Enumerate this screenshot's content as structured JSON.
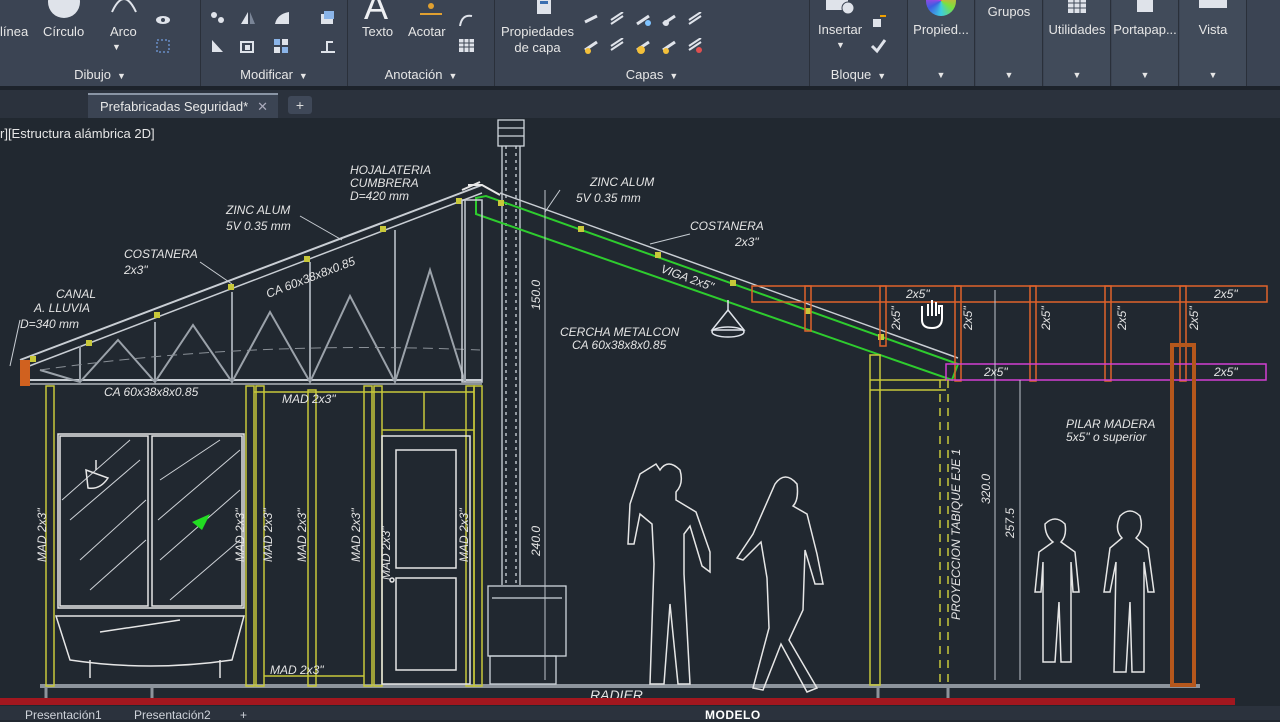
{
  "ribbon": {
    "draw": {
      "linea": "línea",
      "circulo": "Círculo",
      "arco": "Arco",
      "title": "Dibujo"
    },
    "modify": {
      "title": "Modificar"
    },
    "annotation": {
      "texto": "Texto",
      "acotar": "Acotar",
      "title": "Anotación"
    },
    "layers": {
      "prop_line1": "Propiedades",
      "prop_line2": "de capa",
      "title": "Capas"
    },
    "block": {
      "insertar": "Insertar",
      "title": "Bloque"
    },
    "tiles": {
      "propiedades": "Propied...",
      "grupos": "Grupos",
      "utilidades": "Utilidades",
      "portapapeles": "Portapap...",
      "vista": "Vista"
    },
    "dropdown_arrow": "▼"
  },
  "tabs": {
    "document": "Prefabricadas Seguridad*",
    "close": "✕",
    "add": "+"
  },
  "viewport_label": "r][Estructura alámbrica 2D]",
  "drawing": {
    "hojalateria": "HOJALATERIA",
    "cumbrera": "CUMBRERA",
    "hoja_d": "D=420 mm",
    "zinc_left_1": "ZINC ALUM",
    "zinc_left_2": "5V 0.35 mm",
    "zinc_right_1": "ZINC ALUM",
    "zinc_right_2": "5V 0.35 mm",
    "costanera_left_1": "COSTANERA",
    "costanera_left_2": "2x3\"",
    "costanera_right_1": "COSTANERA",
    "costanera_right_2": "2x3\"",
    "canal_1": "CANAL",
    "canal_2": "A. LLUVIA",
    "canal_3": "D=340 mm",
    "ca_truss_top": "CA 60x38x8x0.85",
    "ca_truss_bottom": "CA 60x38x8x0.85",
    "cercha_1": "CERCHA METALCON",
    "cercha_2": "CA 60x38x8x0.85",
    "viga": "VIGA 2x5\"",
    "dim_150": "150.0",
    "dim_240": "240.0",
    "dim_320": "320.0",
    "dim_2575": "257.5",
    "mad_top": "MAD 2x3\"",
    "mad_bottom": "MAD 2x3\"",
    "mad_vert": "MAD 2x3\"",
    "proyeccion": "PROYECCION TABIQUE EJE 1",
    "pilar_1": "PILAR MADERA",
    "pilar_2": "5x5\" o superior",
    "beam_label": "2x5\"",
    "radier": "RADIER"
  },
  "status": {
    "tab1": "Presentación1",
    "tab2": "Presentación2",
    "add": "+",
    "modelo": "MODELO"
  },
  "colors": {
    "ribbon": "#3b4453",
    "canvas": "#212830",
    "yellow": "#c8c83a",
    "green": "#2ecc2e",
    "orange": "#e0622a",
    "magenta": "#d23fd2",
    "brown": "#b5571c",
    "red": "#a2171f"
  }
}
